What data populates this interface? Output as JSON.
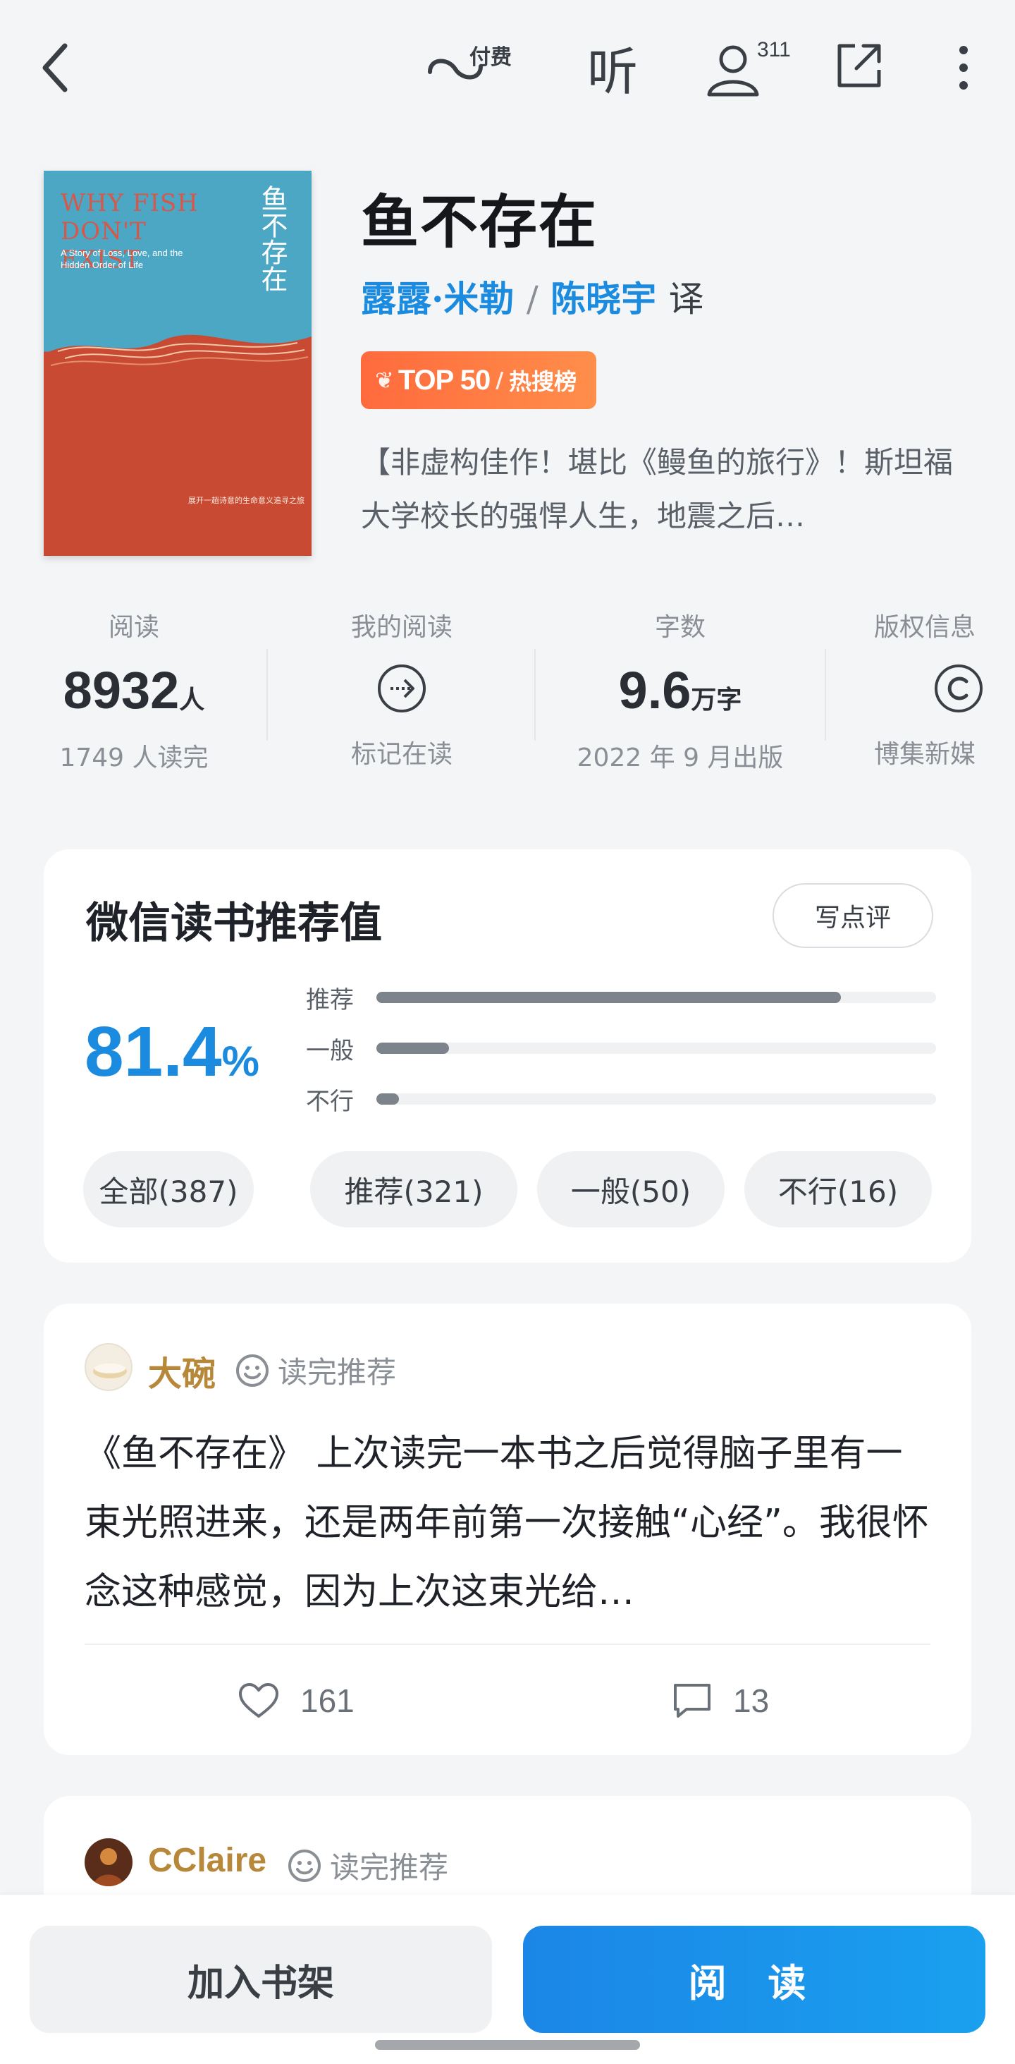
{
  "topbar": {
    "back_icon": "chevron-left-icon",
    "paid_listen_label": "付费",
    "listen_label": "听",
    "followers_count": "311",
    "share_icon": "share-icon",
    "more_icon": "more-vertical-icon"
  },
  "book": {
    "title": "鱼不存在",
    "author": "露露·米勒",
    "separator": "/",
    "translator": "陈晓宇",
    "translator_suffix": "译",
    "rank_badge": {
      "top": "TOP 50",
      "slash": "/",
      "label": "热搜榜"
    },
    "intro": "【非虚构佳作！堪比《鳗鱼的旅行》！斯坦福大学校长的强悍人生，地震之后…",
    "cover": {
      "title_en": "WHY FISH DON'T EXIST",
      "subtitle_en": "A Story of Loss, Love, and the Hidden Order of Life",
      "title_zh": "鱼不存在",
      "blurb": "展开一趟诗意的生命意义追寻之旅"
    }
  },
  "stats": [
    {
      "label": "阅读",
      "value": "8932",
      "unit": "人",
      "sub": "1749 人读完"
    },
    {
      "label": "我的阅读",
      "icon": "arrow-circle-right-icon",
      "sub": "标记在读"
    },
    {
      "label": "字数",
      "value": "9.6",
      "unit": "万字",
      "sub": "2022 年 9 月出版"
    },
    {
      "label": "版权信息",
      "icon": "copyright-icon",
      "sub": "博集新媒"
    }
  ],
  "recommend": {
    "title": "微信读书推荐值",
    "write_button": "写点评",
    "percent_value": "81.4",
    "percent_sign": "%",
    "bars": [
      {
        "label": "推荐",
        "fraction": 0.83
      },
      {
        "label": "一般",
        "fraction": 0.13
      },
      {
        "label": "不行",
        "fraction": 0.04
      }
    ],
    "filters": [
      "全部(387)",
      "推荐(321)",
      "一般(50)",
      "不行(16)"
    ]
  },
  "reviews": [
    {
      "user": "大碗",
      "tag": "读完推荐",
      "text": "《鱼不存在》 上次读完一本书之后觉得脑子里有一束光照进来，还是两年前第一次接触“心经”。我很怀念这种感觉，因为上次这束光给…",
      "likes": "161",
      "comments": "13"
    },
    {
      "user": "CClaire",
      "tag": "读完推荐"
    }
  ],
  "bottom": {
    "add_shelf": "加入书架",
    "read": "阅 读"
  },
  "colors": {
    "accent": "#1a8bdf",
    "username": "#b8883a",
    "rank_badge": "#ff6a3d"
  }
}
